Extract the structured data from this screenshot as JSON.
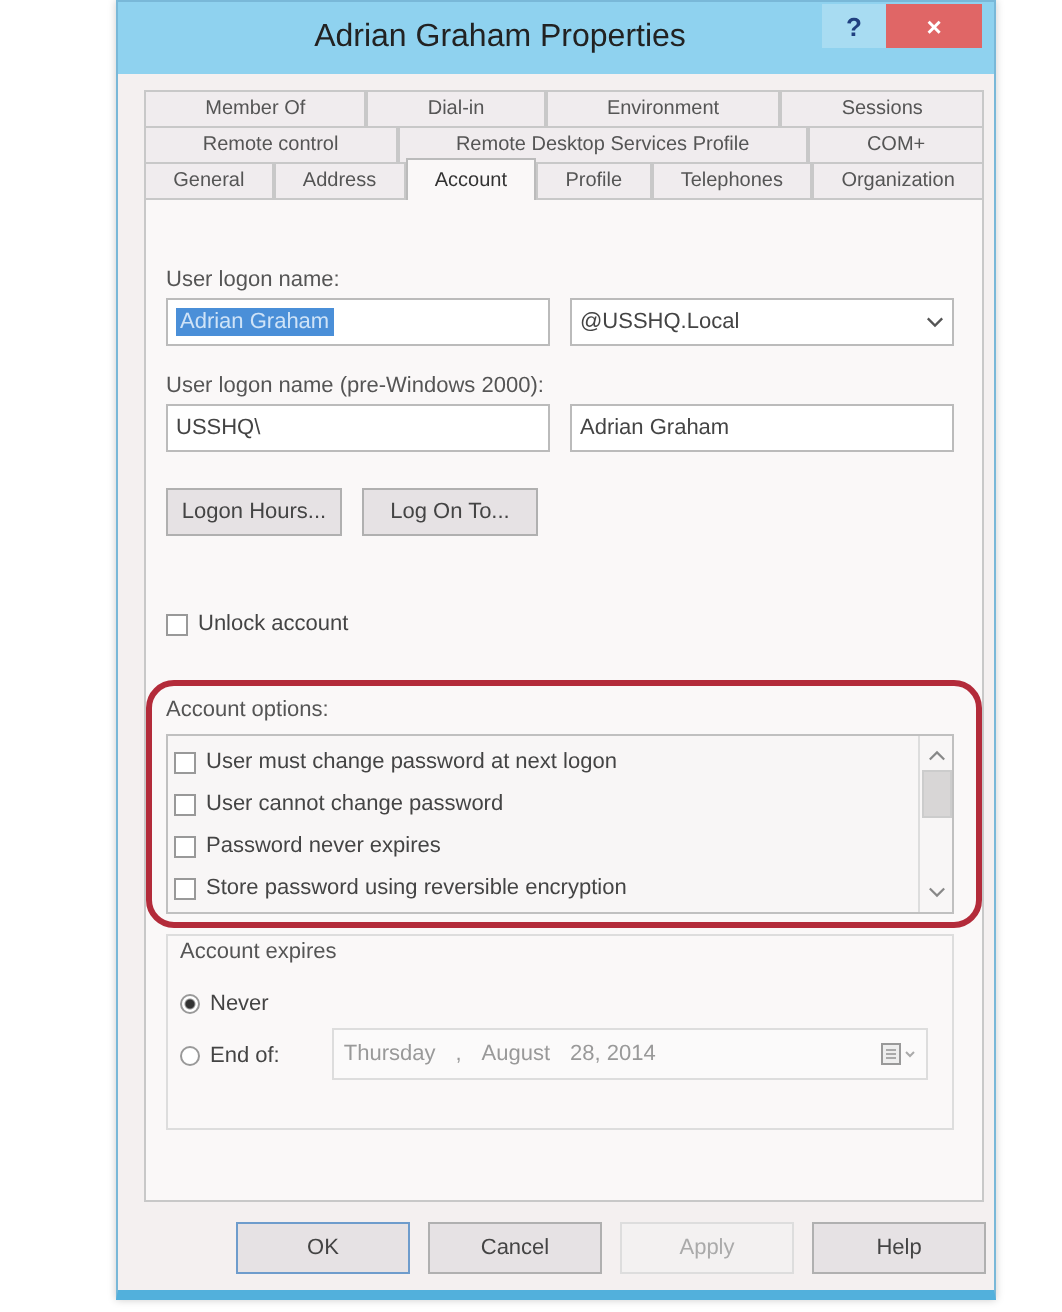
{
  "window": {
    "title": "Adrian Graham Properties",
    "help": "?",
    "close": "×"
  },
  "tab_rows": [
    [
      {
        "label": "Member Of",
        "selected": false
      },
      {
        "label": "Dial-in",
        "selected": false
      },
      {
        "label": "Environment",
        "selected": false
      },
      {
        "label": "Sessions",
        "selected": false
      }
    ],
    [
      {
        "label": "Remote control",
        "selected": false
      },
      {
        "label": "Remote Desktop Services Profile",
        "selected": false
      },
      {
        "label": "COM+",
        "selected": false
      }
    ],
    [
      {
        "label": "General",
        "selected": false
      },
      {
        "label": "Address",
        "selected": false
      },
      {
        "label": "Account",
        "selected": true
      },
      {
        "label": "Profile",
        "selected": false
      },
      {
        "label": "Telephones",
        "selected": false
      },
      {
        "label": "Organization",
        "selected": false
      }
    ]
  ],
  "logon_name": {
    "label": "User logon name:",
    "value": "Adrian Graham",
    "text_selected": true,
    "domain": "@USSHQ.Local"
  },
  "pre2000": {
    "label": "User logon name (pre-Windows 2000):",
    "domain": "USSHQ\\",
    "value": "Adrian Graham"
  },
  "logon_buttons": [
    "Logon Hours...",
    "Log On To..."
  ],
  "unlock": {
    "label": "Unlock account",
    "checked": false
  },
  "account_options": {
    "label": "Account options:",
    "items": [
      {
        "label": "User must change password at next logon",
        "checked": false
      },
      {
        "label": "User cannot change password",
        "checked": false
      },
      {
        "label": "Password never expires",
        "checked": false
      },
      {
        "label": "Store password using reversible encryption",
        "checked": false
      }
    ]
  },
  "account_expires": {
    "label": "Account expires",
    "options": [
      {
        "label": "Never",
        "selected": true
      },
      {
        "label": "End of:",
        "selected": false
      }
    ],
    "date": {
      "disabled": true,
      "parts": [
        "Thursday",
        ",",
        "August",
        "28, 2014"
      ]
    }
  },
  "buttons": [
    {
      "label": "OK",
      "disabled": false,
      "default": true
    },
    {
      "label": "Cancel",
      "disabled": false,
      "default": false
    },
    {
      "label": "Apply",
      "disabled": true,
      "default": false
    },
    {
      "label": "Help",
      "disabled": false,
      "default": false
    }
  ]
}
